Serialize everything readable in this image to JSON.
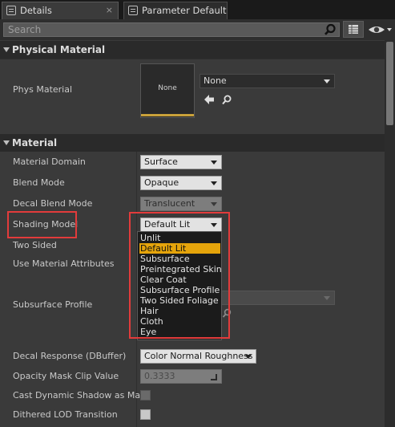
{
  "tabs": [
    {
      "label": "Details",
      "close": "×"
    },
    {
      "label": "Parameter Defaults"
    }
  ],
  "search": {
    "placeholder": "Search"
  },
  "sections": {
    "physical_material": "Physical Material",
    "material": "Material"
  },
  "phys_material": {
    "label": "Phys Material",
    "thumbnail_text": "None",
    "value": "None"
  },
  "properties": {
    "material_domain": {
      "label": "Material Domain",
      "value": "Surface"
    },
    "blend_mode": {
      "label": "Blend Mode",
      "value": "Opaque"
    },
    "decal_blend_mode": {
      "label": "Decal Blend Mode",
      "value": "Translucent"
    },
    "shading_model": {
      "label": "Shading Model",
      "value": "Default Lit"
    },
    "two_sided": {
      "label": "Two Sided"
    },
    "use_material_attributes": {
      "label": "Use Material Attributes"
    },
    "subsurface_profile": {
      "label": "Subsurface Profile"
    },
    "decal_response": {
      "label": "Decal Response (DBuffer)",
      "value": "Color Normal Roughness"
    },
    "opacity_mask_clip_value": {
      "label": "Opacity Mask Clip Value",
      "value": "0.3333"
    },
    "cast_dynamic_shadow": {
      "label": "Cast Dynamic Shadow as Mas"
    },
    "dithered_lod_transition": {
      "label": "Dithered LOD Transition"
    }
  },
  "shading_model_options": [
    "Unlit",
    "Default Lit",
    "Subsurface",
    "Preintegrated Skin",
    "Clear Coat",
    "Subsurface Profile",
    "Two Sided Foliage",
    "Hair",
    "Cloth",
    "Eye"
  ],
  "shading_model_selected_index": 1,
  "colors": {
    "highlight": "#e23b3b",
    "selected_item": "#e5a40b"
  }
}
